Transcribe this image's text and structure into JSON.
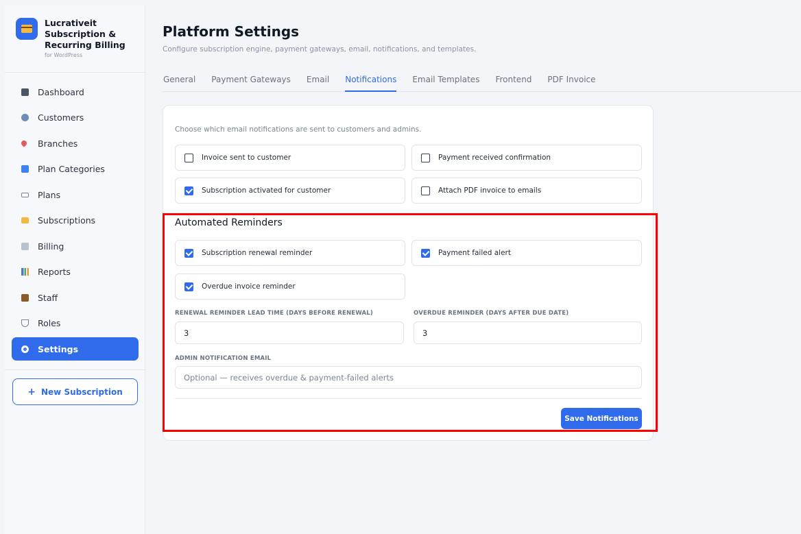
{
  "brand": {
    "title": "Lucrativeit Subscription & Recurring Billing",
    "subtitle": "for WordPress",
    "logo_icon": "credit-card-icon"
  },
  "sidebar": {
    "items": [
      {
        "label": "Dashboard",
        "icon": "dashboard-icon"
      },
      {
        "label": "Customers",
        "icon": "users-icon"
      },
      {
        "label": "Branches",
        "icon": "pin-icon"
      },
      {
        "label": "Plan Categories",
        "icon": "folder-icon"
      },
      {
        "label": "Plans",
        "icon": "tag-icon"
      },
      {
        "label": "Subscriptions",
        "icon": "credit-card-icon"
      },
      {
        "label": "Billing",
        "icon": "receipt-icon"
      },
      {
        "label": "Reports",
        "icon": "bar-chart-icon"
      },
      {
        "label": "Staff",
        "icon": "briefcase-icon"
      },
      {
        "label": "Roles",
        "icon": "shield-icon"
      },
      {
        "label": "Settings",
        "icon": "gear-icon",
        "active": true
      }
    ],
    "new_subscription": {
      "plus": "+",
      "label": "New Subscription"
    }
  },
  "header": {
    "title": "Platform Settings",
    "subtitle": "Configure subscription engine, payment gateways, email, notifications, and templates."
  },
  "tabs": [
    {
      "label": "General"
    },
    {
      "label": "Payment Gateways"
    },
    {
      "label": "Email"
    },
    {
      "label": "Notifications",
      "active": true
    },
    {
      "label": "Email Templates"
    },
    {
      "label": "Frontend"
    },
    {
      "label": "PDF Invoice"
    }
  ],
  "notifications": {
    "intro": "Choose which email notifications are sent to customers and admins.",
    "options": [
      {
        "label": "Invoice sent to customer",
        "checked": false
      },
      {
        "label": "Payment received confirmation",
        "checked": false
      },
      {
        "label": "Subscription activated for customer",
        "checked": true
      },
      {
        "label": "Attach PDF invoice to emails",
        "checked": false
      }
    ]
  },
  "reminders": {
    "title": "Automated Reminders",
    "options": [
      {
        "label": "Subscription renewal reminder",
        "checked": true
      },
      {
        "label": "Payment failed alert",
        "checked": true
      },
      {
        "label": "Overdue invoice reminder",
        "checked": true
      }
    ],
    "renewal_lead_label": "RENEWAL REMINDER LEAD TIME (DAYS BEFORE RENEWAL)",
    "renewal_lead_value": "3",
    "overdue_label": "OVERDUE REMINDER (DAYS AFTER DUE DATE)",
    "overdue_value": "3",
    "admin_email_label": "ADMIN NOTIFICATION EMAIL",
    "admin_email_placeholder": "Optional — receives overdue & payment-failed alerts",
    "save_label": "Save Notifications"
  },
  "colors": {
    "accent": "#2f6bea",
    "highlight": "#ff0000"
  }
}
